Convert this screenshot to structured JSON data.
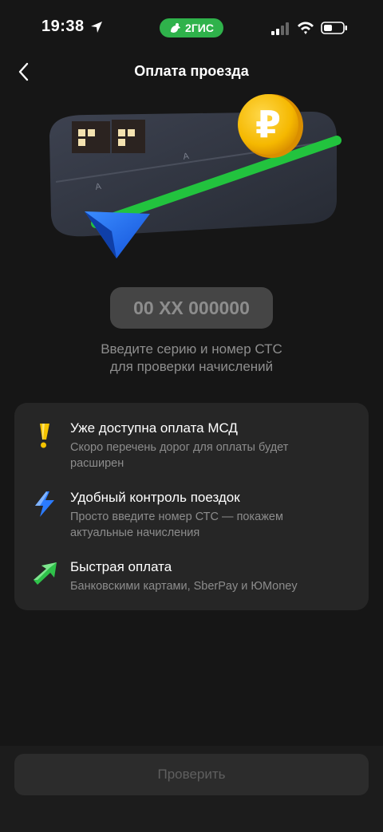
{
  "status_bar": {
    "time": "19:38",
    "app_badge": "2ГИС",
    "icons": [
      "location-arrow-icon",
      "signal-icon",
      "wifi-icon",
      "battery-icon"
    ]
  },
  "header": {
    "title": "Оплата проезда",
    "back_icon": "chevron-left-icon"
  },
  "hero": {
    "coin_symbol": "₽"
  },
  "plate": {
    "placeholder": "00 XX 000000",
    "value": ""
  },
  "hint": {
    "line1": "Введите серию и номер СТС",
    "line2": "для проверки начислений"
  },
  "features": [
    {
      "icon": "exclamation-icon",
      "title": "Уже доступна оплата МСД",
      "description": "Скоро перечень дорог для оплаты будет расширен"
    },
    {
      "icon": "lightning-icon",
      "title": "Удобный контроль поездок",
      "description": "Просто введите номер СТС — покажем актуальные начисления"
    },
    {
      "icon": "arrow-up-right-icon",
      "title": "Быстрая оплата",
      "description": "Банковскими картами, SberPay и ЮMoney"
    }
  ],
  "footer": {
    "check_label": "Проверить"
  },
  "colors": {
    "background": "#161616",
    "card": "#262626",
    "accent_green": "#2fb24b",
    "coin_gold": "#f5b800",
    "arrow_blue": "#1f6ff0",
    "button_disabled": "#2c2c2c"
  }
}
